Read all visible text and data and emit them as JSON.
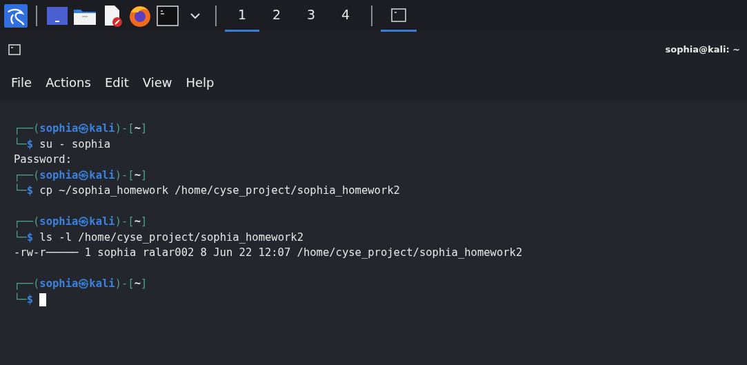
{
  "taskbar": {
    "workspaces": [
      {
        "label": "1",
        "selected": true
      },
      {
        "label": "2",
        "selected": false
      },
      {
        "label": "3",
        "selected": false
      },
      {
        "label": "4",
        "selected": false
      }
    ],
    "tasks": [
      {
        "selected": true
      }
    ]
  },
  "window": {
    "title": "sophia@kali: ~"
  },
  "menu": [
    "File",
    "Actions",
    "Edit",
    "View",
    "Help"
  ],
  "terminal": [
    {
      "kind": "prompt",
      "top": "┌──(",
      "user_host": "sophia㉿kali",
      "mid": ")-[",
      "dir": "~",
      "close": "]",
      "bottom": "└─",
      "dollar": "$",
      "command": "su - sophia"
    },
    {
      "kind": "output",
      "text": "Password:"
    },
    {
      "kind": "prompt",
      "top": "┌──(",
      "user_host": "sophia㉿kali",
      "mid": ")-[",
      "dir": "~",
      "close": "]",
      "bottom": "└─",
      "dollar": "$",
      "command": "cp ~/sophia_homework /home/cyse_project/sophia_homework2"
    },
    {
      "kind": "blank"
    },
    {
      "kind": "prompt",
      "top": "┌──(",
      "user_host": "sophia㉿kali",
      "mid": ")-[",
      "dir": "~",
      "close": "]",
      "bottom": "└─",
      "dollar": "$",
      "command": "ls -l /home/cyse_project/sophia_homework2"
    },
    {
      "kind": "output",
      "text": "-rw-r───── 1 sophia ralar002 8 Jun 22 12:07 /home/cyse_project/sophia_homework2"
    },
    {
      "kind": "blank"
    },
    {
      "kind": "prompt",
      "top": "┌──(",
      "user_host": "sophia㉿kali",
      "mid": ")-[",
      "dir": "~",
      "close": "]",
      "bottom": "└─",
      "dollar": "$",
      "cursor": true
    }
  ]
}
